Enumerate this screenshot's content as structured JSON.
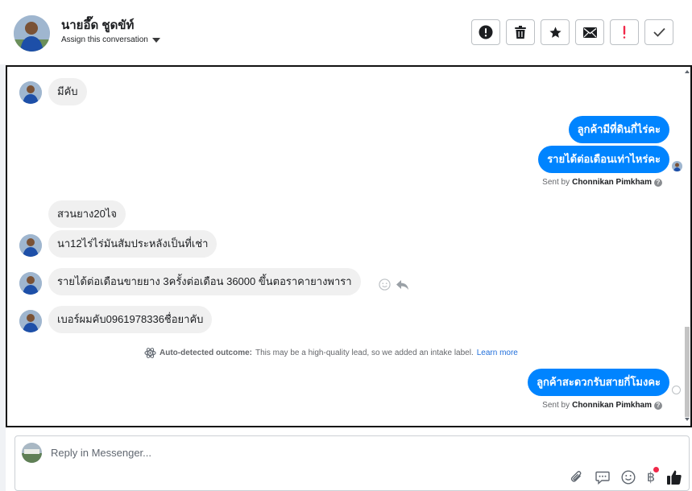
{
  "header": {
    "contact_name": "นายอึ๊ด ชูดขัท์",
    "assign_label": "Assign this conversation",
    "actions": [
      {
        "icon": "alert-circle-icon",
        "name": "mark-spam-button"
      },
      {
        "icon": "trash-icon",
        "name": "delete-button"
      },
      {
        "icon": "star-icon",
        "name": "star-button"
      },
      {
        "icon": "envelope-icon",
        "name": "mark-unread-button"
      },
      {
        "icon": "exclamation-icon",
        "name": "follow-up-button"
      },
      {
        "icon": "check-icon",
        "name": "mark-done-button"
      }
    ]
  },
  "messages": {
    "m1": "มีคับ",
    "m2": "ลูกค้ามีที่ดินกี่ไร่คะ",
    "m3": "รายได้ต่อเดือนเท่าไหร่คะ",
    "m4": "สวนยาง20ไจ",
    "m5": "นา12ไร่ไร่มันสัมประหลังเป็นที่เช่า",
    "m6": "รายได้ต่อเดือนขายยาง 3ครั้งต่อเดือน 36000 ขึ้นตอราคายางพารา",
    "m7": "เบอร์ผมคับ0961978336ชื่อยาคับ",
    "m8": "ลูกค้าสะดวกรับสายกี่โมงคะ"
  },
  "sent_by": {
    "prefix": "Sent by",
    "name": "Chonnikan Pimkham",
    "help": "?"
  },
  "outcome": {
    "label": "Auto-detected outcome:",
    "text": "This may be a high-quality lead, so we added an intake label.",
    "link": "Learn more"
  },
  "composer": {
    "placeholder": "Reply in Messenger...",
    "tools": [
      "paperclip-icon",
      "saved-reply-icon",
      "emoji-icon",
      "baht-icon",
      "thumbs-up-icon"
    ],
    "baht_symbol": "฿"
  },
  "colors": {
    "outgoing": "#0084ff",
    "incoming": "#f0f0f0",
    "link": "#216fdb",
    "badge": "#f02849"
  }
}
